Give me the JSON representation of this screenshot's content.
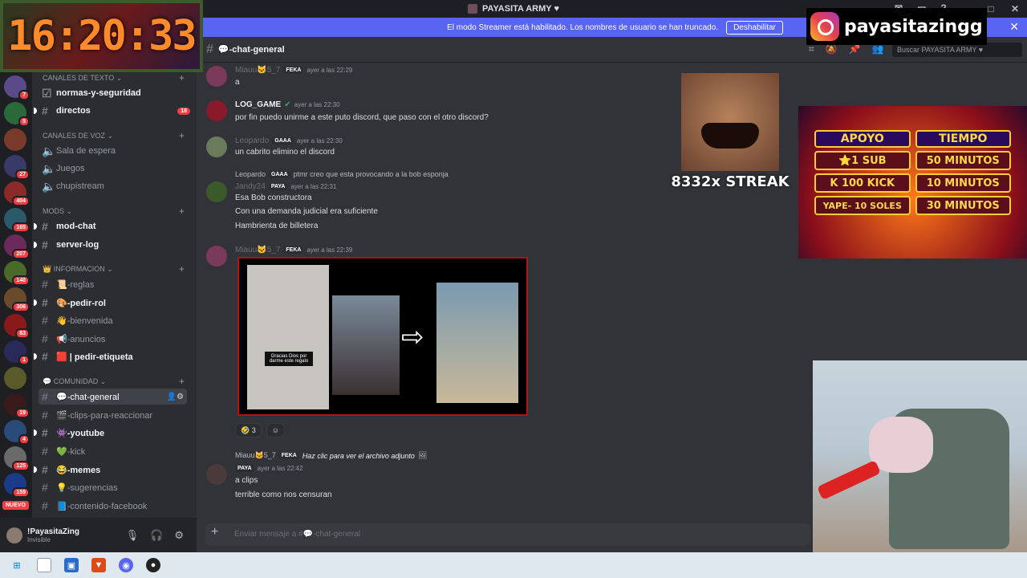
{
  "window": {
    "title": "PAYASITA ARMY ♥"
  },
  "banner": {
    "text": "El modo Streamer está habilitado. Los nombres de usuario se han truncado.",
    "button": "Deshabilitar"
  },
  "clock": {
    "time": "16:20:33"
  },
  "server_badges": [
    "7",
    "5",
    "",
    "27",
    "404",
    "165",
    "207",
    "140",
    "306",
    "83",
    "1",
    "",
    "19",
    "4",
    "125",
    "159"
  ],
  "nuevo_label": "NUEVO",
  "sidebar": {
    "cat_text": "Canales de texto",
    "ch_normas": "normas-y-seguridad",
    "ch_directos": "directos",
    "ch_directos_count": "18",
    "cat_voice": "Canales de voz",
    "ch_sala": "Sala de espera",
    "ch_juegos": "Juegos",
    "ch_chupi": "chupistream",
    "cat_mods": "MODS",
    "ch_modchat": "mod-chat",
    "ch_serverlog": "server-log",
    "cat_info": "INFORMACION",
    "ch_reglas": "📜-reglas",
    "ch_pedirrol": "🎨-pedir-rol",
    "ch_bienvenida": "👋-bienvenida",
    "ch_anuncios": "📢-anuncios",
    "ch_etiqueta": "🟥 | pedir-etiqueta",
    "cat_comunidad": "COMUNIDAD",
    "ch_general": "💬-chat-general",
    "ch_clips": "🎬-clips-para-reaccionar",
    "ch_youtube": "👾-youtube",
    "ch_kick": "💚-kick",
    "ch_memes": "😂-memes",
    "ch_sugerencias": "💡-sugerencias",
    "ch_facebook": "📘-contenido-facebook"
  },
  "user": {
    "name": "!PayasitaZing",
    "status": "Invisible"
  },
  "chat": {
    "channel": "💬-chat-general",
    "search_placeholder": "Buscar PAYASITA ARMY ♥",
    "composer_placeholder": "Enviar mensaje a #💬-chat-general"
  },
  "messages": {
    "m1": {
      "author": "Miauu🐱5_7",
      "tag": "FEKA",
      "time": "ayer a las 22:29",
      "text": "a"
    },
    "m2": {
      "author": "LOG_GAME",
      "time": "ayer a las 22:30",
      "text": "por fin puedo unirme a este puto discord, que paso con el otro discord?"
    },
    "m3": {
      "author": "Leopardo",
      "tag": "GAAA",
      "time": "ayer a las 22:30",
      "text": "un cabrito elimino el discord"
    },
    "m4": {
      "reply_author": "Leopardo",
      "reply_tag": "GAAA",
      "reply_text": "ptmr creo que esta provocando a la bob esponja",
      "author": "Jandy24",
      "tag": "PAYA",
      "time": "ayer a las 22:31",
      "line1": "Esa Bob constructora",
      "line2": "Con una demanda judicial era suficiente",
      "line3": "Hambrienta de billetera"
    },
    "m5": {
      "author": "Miauu🐱5_7",
      "tag": "FEKA",
      "time": "ayer a las 22:39",
      "reaction_count": "3"
    },
    "m6": {
      "reply_author": "Miauu🐱5_7",
      "reply_tag": "FEKA",
      "reply_text": "Haz clic para ver el archivo adjunto",
      "tag": "PAYA",
      "time": "ayer a las 22:42",
      "line1": "a clips",
      "line2": "terrible como nos censuran"
    }
  },
  "attachment": {
    "caption": "Gracias Dios por darme este regalo"
  },
  "overlay": {
    "instagram": "payasitazingg",
    "streak": "8332x STREAK",
    "prices_header": [
      "APOYO",
      "TIEMPO"
    ],
    "prices_rows": [
      {
        "left": "⭐1 SUB",
        "right": "50 MINUTOS"
      },
      {
        "left": "K 100 KICK",
        "right": "10 MINUTOS"
      },
      {
        "left": "YAPE- 10 SOLES",
        "right": "30 MINUTOS"
      }
    ]
  },
  "colors": {
    "accent": "#5865f2",
    "danger": "#f23f43",
    "bg": "#313338",
    "sidebar": "#2b2d31"
  }
}
